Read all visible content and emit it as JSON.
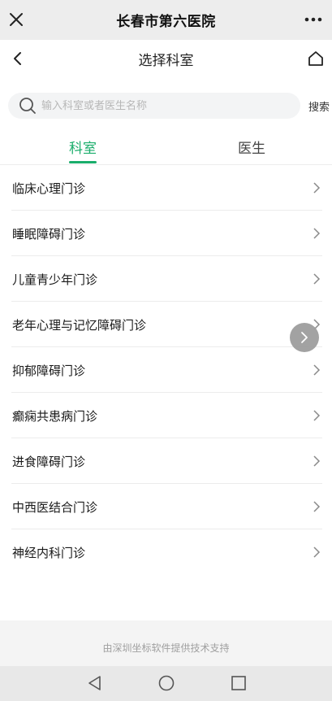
{
  "header": {
    "title": "长春市第六医院",
    "close_icon": "close-icon",
    "more_icon": "more-dots-icon"
  },
  "nav": {
    "title": "选择科室",
    "back_icon": "chevron-left-icon",
    "home_icon": "home-icon"
  },
  "search": {
    "placeholder": "输入科室或者医生名称",
    "value": "",
    "button_label": "搜索"
  },
  "tabs": [
    {
      "label": "科室",
      "active": true
    },
    {
      "label": "医生",
      "active": false
    }
  ],
  "departments": [
    {
      "label": "临床心理门诊"
    },
    {
      "label": "睡眠障碍门诊"
    },
    {
      "label": "儿童青少年门诊"
    },
    {
      "label": "老年心理与记忆障碍门诊"
    },
    {
      "label": "抑郁障碍门诊"
    },
    {
      "label": "癫痫共患病门诊"
    },
    {
      "label": "进食障碍门诊"
    },
    {
      "label": "中西医结合门诊"
    },
    {
      "label": "神经内科门诊"
    }
  ],
  "footer": {
    "text": "由深圳坐标软件提供技术支持"
  },
  "colors": {
    "accent": "#1aad6b",
    "topbar_bg": "#ededed",
    "float_button": "#9e9e9e"
  }
}
